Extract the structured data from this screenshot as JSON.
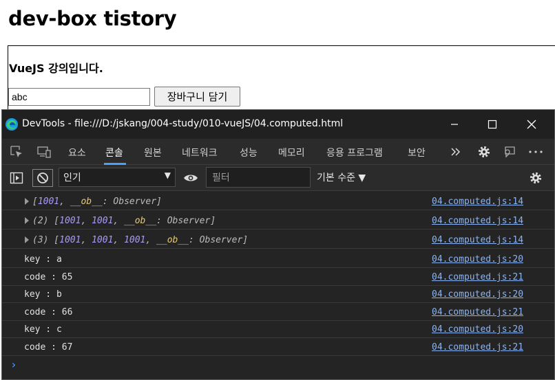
{
  "page": {
    "title": "dev-box tistory",
    "course_title": "VueJS 강의입니다.",
    "input_value": "abc",
    "cart_button": "장바구니 담기"
  },
  "devtools": {
    "window_title": "DevTools - file:///D:/jskang/004-study/010-vueJS/04.computed.html",
    "tabs": [
      "요소",
      "콘솔",
      "원본",
      "네트워크",
      "성능",
      "메모리",
      "응용 프로그램",
      "보안"
    ],
    "active_tab": "콘솔",
    "toolbar": {
      "context": "인기",
      "filter_placeholder": "필터",
      "level": "기본 수준 ▼"
    },
    "console_rows": [
      {
        "text": "key : a",
        "source": "04.computed.js:20"
      },
      {
        "text": "code : 65",
        "source": "04.computed.js:21"
      },
      {
        "text": "key : b",
        "source": "04.computed.js:20"
      },
      {
        "text": "code : 66",
        "source": "04.computed.js:21"
      },
      {
        "text": "key : c",
        "source": "04.computed.js:20"
      },
      {
        "text": "code : 67",
        "source": "04.computed.js:21"
      }
    ],
    "object_rows": [
      {
        "source": "04.computed.js:14"
      },
      {
        "count": "(2)",
        "source": "04.computed.js:14"
      },
      {
        "count": "(3)",
        "source": "04.computed.js:14"
      }
    ],
    "tokens": {
      "num": "1001",
      "ob": "__ob__",
      "observer": ": Observer]"
    }
  },
  "colors": {
    "accent": "#4aa0ff",
    "link": "#8cb4f2",
    "console_bg": "#242424",
    "number": "#a89bf7"
  }
}
